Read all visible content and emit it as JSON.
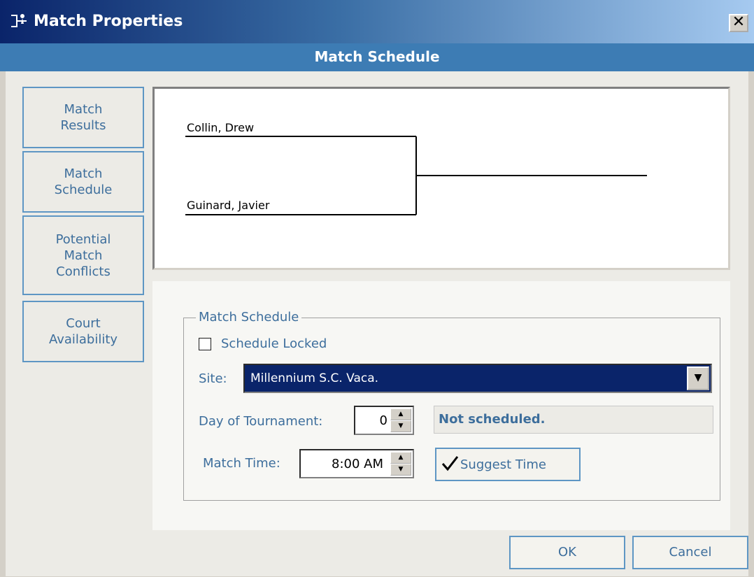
{
  "window": {
    "title": "Match Properties",
    "close_label": "✕"
  },
  "header": {
    "title": "Match Schedule"
  },
  "nav": {
    "items": [
      {
        "line1": "Match",
        "line2": "Results"
      },
      {
        "line1": "Match",
        "line2": "Schedule"
      },
      {
        "line1": "Potential",
        "line2": "Match",
        "line3": "Conflicts"
      },
      {
        "line1": "Court",
        "line2": "Availability"
      }
    ]
  },
  "bracket": {
    "player1": "Collin, Drew",
    "player2": "Guinard, Javier"
  },
  "schedule": {
    "group_title": "Match Schedule",
    "locked_label": "Schedule Locked",
    "locked_checked": false,
    "site_label": "Site:",
    "site_value": "Millennium S.C. Vaca.",
    "day_label": "Day of Tournament:",
    "day_value": "0",
    "status_text": "Not scheduled.",
    "time_label": "Match Time:",
    "time_value": "8:00 AM",
    "suggest_label": "Suggest Time"
  },
  "footer": {
    "ok_label": "OK",
    "cancel_label": "Cancel"
  }
}
